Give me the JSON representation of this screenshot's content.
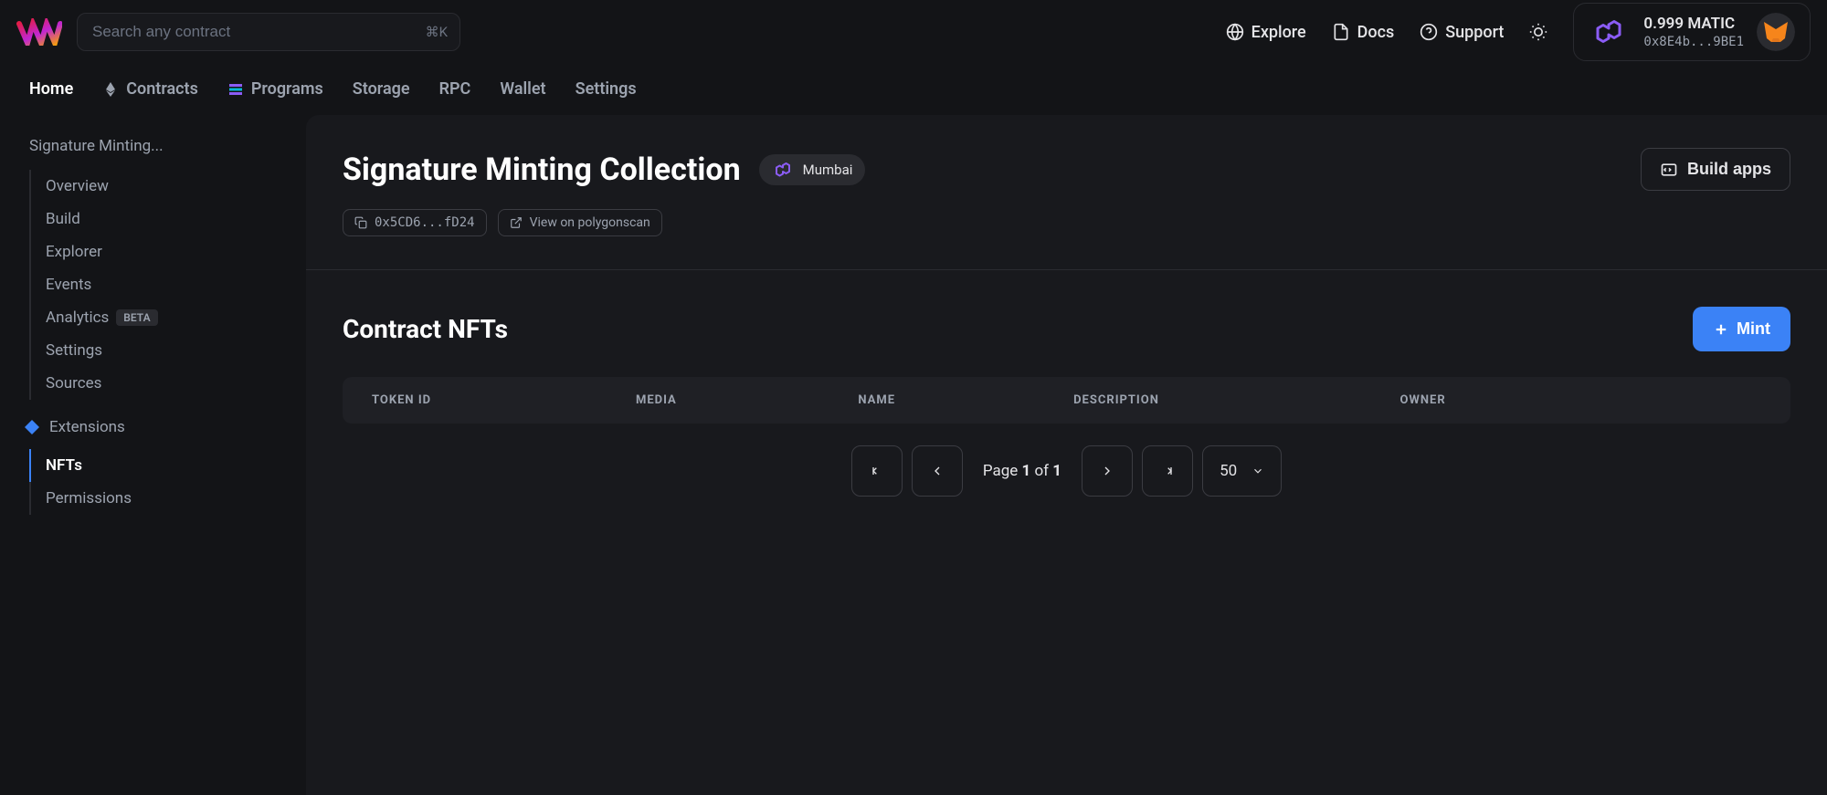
{
  "search": {
    "placeholder": "Search any contract",
    "shortcut": "⌘K"
  },
  "headerLinks": {
    "explore": "Explore",
    "docs": "Docs",
    "support": "Support"
  },
  "wallet": {
    "balance": "0.999 MATIC",
    "address": "0x8E4b...9BE1"
  },
  "navTabs": {
    "home": "Home",
    "contracts": "Contracts",
    "programs": "Programs",
    "storage": "Storage",
    "rpc": "RPC",
    "wallet": "Wallet",
    "settings": "Settings"
  },
  "sidebar": {
    "contractName": "Signature Minting...",
    "items": {
      "overview": "Overview",
      "build": "Build",
      "explorer": "Explorer",
      "events": "Events",
      "analytics": "Analytics",
      "analyticsBadge": "BETA",
      "settings": "Settings",
      "sources": "Sources"
    },
    "extensions": {
      "label": "Extensions",
      "nfts": "NFTs",
      "permissions": "Permissions"
    }
  },
  "content": {
    "title": "Signature Minting Collection",
    "network": "Mumbai",
    "contractAddress": "0x5CD6...fD24",
    "viewOnExplorer": "View on polygonscan",
    "buildApps": "Build apps",
    "sectionTitle": "Contract NFTs",
    "mintButton": "Mint",
    "tableColumns": {
      "tokenId": "TOKEN ID",
      "media": "MEDIA",
      "name": "NAME",
      "description": "DESCRIPTION",
      "owner": "OWNER"
    },
    "pagination": {
      "pageLabel": "Page",
      "currentPage": "1",
      "ofLabel": "of",
      "totalPages": "1",
      "pageSize": "50"
    }
  }
}
